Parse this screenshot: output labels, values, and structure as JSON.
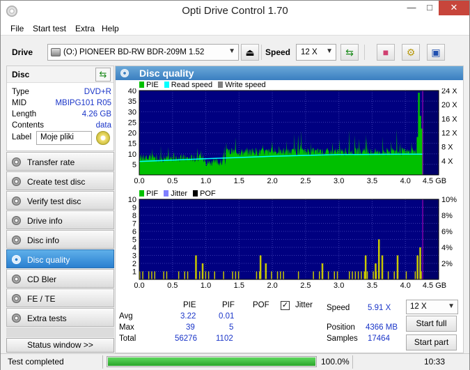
{
  "window": {
    "title": "Opti Drive Control 1.70"
  },
  "menu": [
    "File",
    "Start test",
    "Extra",
    "Help"
  ],
  "toolbar": {
    "drive_label": "Drive",
    "drive_value": "(O:)  PIONEER BD-RW   BDR-209M 1.52",
    "speed_label": "Speed",
    "speed_value": "12 X"
  },
  "disc": {
    "header": "Disc",
    "rows": [
      {
        "key": "Type",
        "value": "DVD+R"
      },
      {
        "key": "MID",
        "value": "MBIPG101 R05"
      },
      {
        "key": "Length",
        "value": "4.26 GB"
      },
      {
        "key": "Contents",
        "value": "data"
      }
    ],
    "label_key": "Label",
    "label_value": "Moje pliki"
  },
  "nav": {
    "items": [
      {
        "label": "Transfer rate",
        "active": false
      },
      {
        "label": "Create test disc",
        "active": false
      },
      {
        "label": "Verify test disc",
        "active": false
      },
      {
        "label": "Drive info",
        "active": false
      },
      {
        "label": "Disc info",
        "active": false
      },
      {
        "label": "Disc quality",
        "active": true
      },
      {
        "label": "CD Bler",
        "active": false
      },
      {
        "label": "FE / TE",
        "active": false
      },
      {
        "label": "Extra tests",
        "active": false
      }
    ],
    "status_window": "Status window >>"
  },
  "panel": {
    "title": "Disc quality",
    "legend1": [
      "PIE",
      "Read speed",
      "Write speed"
    ],
    "legend2": [
      "PIF",
      "Jitter",
      "POF"
    ]
  },
  "stats": {
    "col_headers": [
      "PIE",
      "PIF",
      "POF",
      "Jitter"
    ],
    "jitter_checked": "✓",
    "rows": [
      {
        "label": "Avg",
        "pie": "3.22",
        "pif": "0.01"
      },
      {
        "label": "Max",
        "pie": "39",
        "pif": "5"
      },
      {
        "label": "Total",
        "pie": "56276",
        "pif": "1102"
      }
    ],
    "speed_label": "Speed",
    "speed_value": "5.91 X",
    "position_label": "Position",
    "position_value": "4366 MB",
    "samples_label": "Samples",
    "samples_value": "17464",
    "speed_select": "12 X",
    "start_full": "Start full",
    "start_part": "Start part"
  },
  "status": {
    "text": "Test completed",
    "progress": 1.0,
    "percent": "100.0%",
    "time": "10:33"
  },
  "colors": {
    "pie": "#00c000",
    "read_speed": "#00ffff",
    "write_speed": "#808080",
    "pif": "#c8c800",
    "jitter": "#8080ff",
    "pof": "#000000",
    "plot_bg": "#000080",
    "disc_end_marker": "#c000c0"
  },
  "chart_data": [
    {
      "type": "bar",
      "series": [
        {
          "name": "PIE",
          "peak_x": [
            4.18,
            4.2,
            4.22,
            4.24
          ],
          "peak_y": [
            18,
            39,
            28,
            22
          ]
        },
        {
          "name": "Read speed",
          "x": [
            0,
            1,
            2,
            3,
            4,
            4.26
          ],
          "y": [
            3.8,
            4.6,
            5.3,
            5.8,
            5.9,
            5.91
          ]
        }
      ],
      "x_ticks": [
        "0.0",
        "0.5",
        "1.0",
        "1.5",
        "2.0",
        "2.5",
        "3.0",
        "3.5",
        "4.0",
        "4.5 GB"
      ],
      "y_ticks_left": [
        "5",
        "10",
        "15",
        "20",
        "25",
        "30",
        "35",
        "40"
      ],
      "y_ticks_right": [
        "4 X",
        "8 X",
        "12 X",
        "16 X",
        "20 X",
        "24 X"
      ],
      "xlim": [
        0,
        4.5
      ],
      "ylim": [
        0,
        40
      ],
      "y2lim": [
        0,
        24
      ],
      "disc_end": 4.26
    },
    {
      "type": "bar",
      "series": [
        {
          "name": "PIF",
          "x": [
            0.85,
            0.95,
            1.82,
            1.9,
            2.75,
            3.4,
            3.55,
            3.6,
            3.65,
            3.88,
            4.18,
            4.22
          ],
          "y": [
            3,
            2,
            3,
            2,
            2,
            3,
            2,
            5,
            3,
            3,
            3,
            4
          ]
        }
      ],
      "x_ticks": [
        "0.0",
        "0.5",
        "1.0",
        "1.5",
        "2.0",
        "2.5",
        "3.0",
        "3.5",
        "4.0",
        "4.5 GB"
      ],
      "y_ticks_left": [
        "1",
        "2",
        "3",
        "4",
        "5",
        "6",
        "7",
        "8",
        "9",
        "10"
      ],
      "y_ticks_right": [
        "2%",
        "4%",
        "6%",
        "8%",
        "10%"
      ],
      "xlim": [
        0,
        4.5
      ],
      "ylim": [
        0,
        10
      ],
      "y2lim": [
        0,
        10
      ],
      "disc_end": 4.26
    }
  ]
}
